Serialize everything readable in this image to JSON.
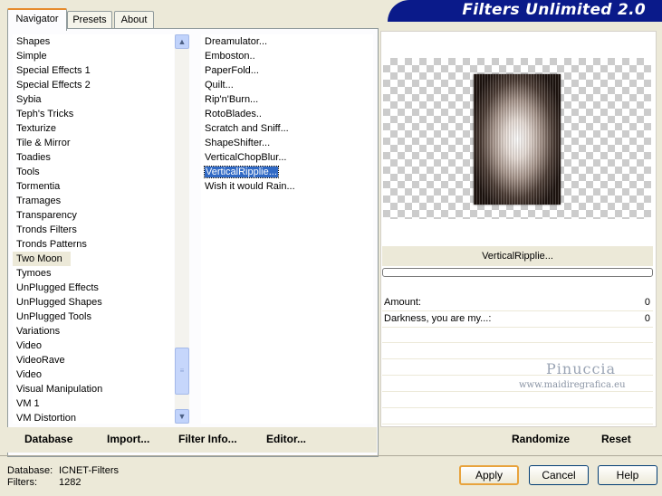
{
  "tabs": [
    {
      "label": "Navigator",
      "active": true
    },
    {
      "label": "Presets",
      "active": false
    },
    {
      "label": "About",
      "active": false
    }
  ],
  "header": {
    "title": "Filters Unlimited 2.0"
  },
  "categories": [
    {
      "label": "Shapes"
    },
    {
      "label": "Simple"
    },
    {
      "label": "Special Effects 1"
    },
    {
      "label": "Special Effects 2"
    },
    {
      "label": "Sybia"
    },
    {
      "label": "Teph's Tricks"
    },
    {
      "label": "Texturize"
    },
    {
      "label": "Tile & Mirror"
    },
    {
      "label": "Toadies"
    },
    {
      "label": "Tools"
    },
    {
      "label": "Tormentia"
    },
    {
      "label": "Tramages"
    },
    {
      "label": "Transparency"
    },
    {
      "label": "Tronds Filters"
    },
    {
      "label": "Tronds Patterns"
    },
    {
      "label": "Two Moon",
      "highlighted": true
    },
    {
      "label": "Tymoes"
    },
    {
      "label": "UnPlugged Effects"
    },
    {
      "label": "UnPlugged Shapes"
    },
    {
      "label": "UnPlugged Tools"
    },
    {
      "label": "Variations"
    },
    {
      "label": "Video"
    },
    {
      "label": "VideoRave"
    },
    {
      "label": "Video"
    },
    {
      "label": "Visual Manipulation"
    },
    {
      "label": "VM 1"
    },
    {
      "label": "VM Distortion"
    }
  ],
  "filters": [
    {
      "label": "Dreamulator..."
    },
    {
      "label": "Emboston.."
    },
    {
      "label": "PaperFold..."
    },
    {
      "label": "Quilt..."
    },
    {
      "label": "Rip'n'Burn..."
    },
    {
      "label": "RotoBlades.."
    },
    {
      "label": "Scratch and Sniff..."
    },
    {
      "label": "ShapeShifter..."
    },
    {
      "label": "VerticalChopBlur..."
    },
    {
      "label": "VerticalRipplie...",
      "selected": true
    },
    {
      "label": "Wish it would Rain..."
    }
  ],
  "preview": {
    "filter_name": "VerticalRipplie...",
    "progress": 0
  },
  "params": [
    {
      "label": "Amount:",
      "value": "0"
    },
    {
      "label": "Darkness, you are my...:",
      "value": "0"
    }
  ],
  "watermark": {
    "name": "Pinuccia",
    "url": "www.maidiregrafica.eu"
  },
  "toolbar": {
    "database": "Database",
    "import": "Import...",
    "filter_info": "Filter Info...",
    "editor": "Editor...",
    "randomize": "Randomize",
    "reset": "Reset"
  },
  "status": {
    "database_label": "Database:",
    "database_value": "ICNET-Filters",
    "filters_label": "Filters:",
    "filters_value": "1282"
  },
  "dialog": {
    "apply": "Apply",
    "cancel": "Cancel",
    "help": "Help"
  }
}
